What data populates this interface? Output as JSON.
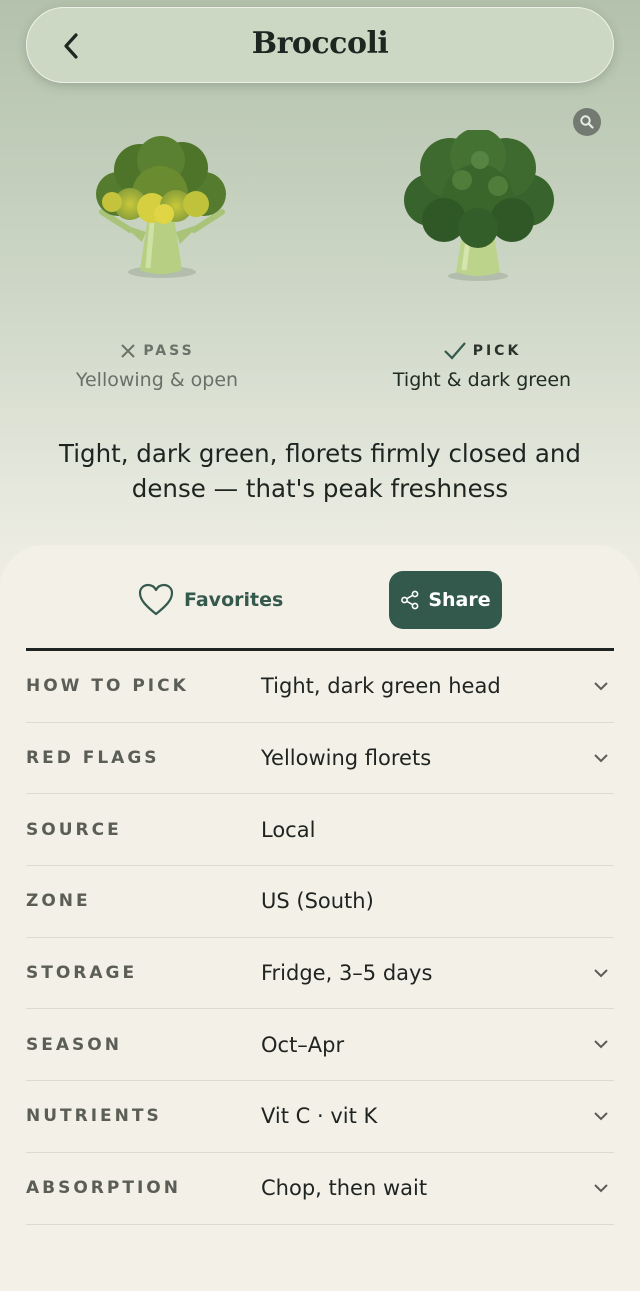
{
  "header": {
    "title": "Broccoli"
  },
  "comparison": {
    "pass": {
      "tag": "PASS",
      "description": "Yellowing & open"
    },
    "pick": {
      "tag": "PICK",
      "description": "Tight & dark green"
    }
  },
  "headline": "Tight, dark green, florets firmly closed and dense — that's peak freshness",
  "actions": {
    "favorites_label": "Favorites",
    "share_label": "Share"
  },
  "details": [
    {
      "label": "HOW TO PICK",
      "value": "Tight, dark green head",
      "expandable": true
    },
    {
      "label": "RED FLAGS",
      "value": "Yellowing florets",
      "expandable": true
    },
    {
      "label": "SOURCE",
      "value": "Local",
      "expandable": false
    },
    {
      "label": "ZONE",
      "value": "US (South)",
      "expandable": false
    },
    {
      "label": "STORAGE",
      "value": "Fridge, 3–5 days",
      "expandable": true
    },
    {
      "label": "SEASON",
      "value": "Oct–Apr",
      "expandable": true
    },
    {
      "label": "NUTRIENTS",
      "value": "Vit C · vit K",
      "expandable": true
    },
    {
      "label": "ABSORPTION",
      "value": "Chop, then wait",
      "expandable": true
    }
  ],
  "colors": {
    "accent": "#33594d",
    "background": "#f3f0e8",
    "hero": "#c3cfbc"
  },
  "icons": [
    "back-icon",
    "zoom-icon",
    "x-icon",
    "check-icon",
    "heart-icon",
    "share-icon",
    "chevron-down-icon"
  ]
}
